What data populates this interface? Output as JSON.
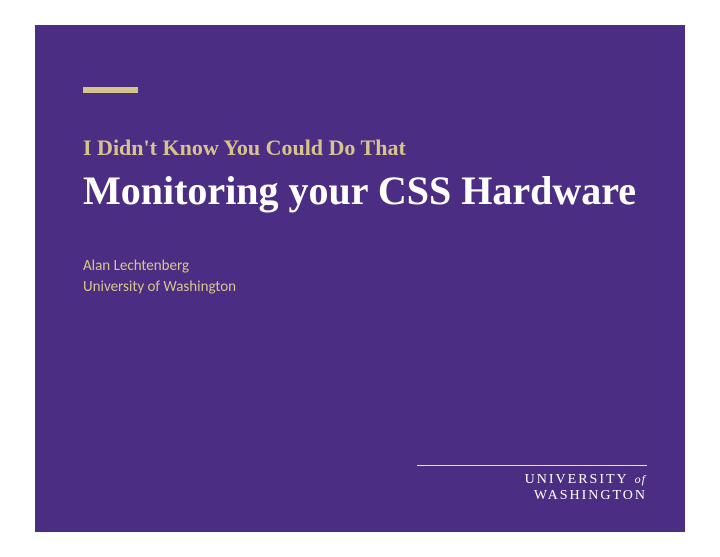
{
  "slide": {
    "kicker": "I Didn't Know You Could Do That",
    "title": "Monitoring your CSS Hardware",
    "author": "Alan Lechtenberg",
    "affiliation": "University of Washington"
  },
  "footer": {
    "word1": "UNIVERSITY",
    "of": "of",
    "word2": "WASHINGTON"
  }
}
